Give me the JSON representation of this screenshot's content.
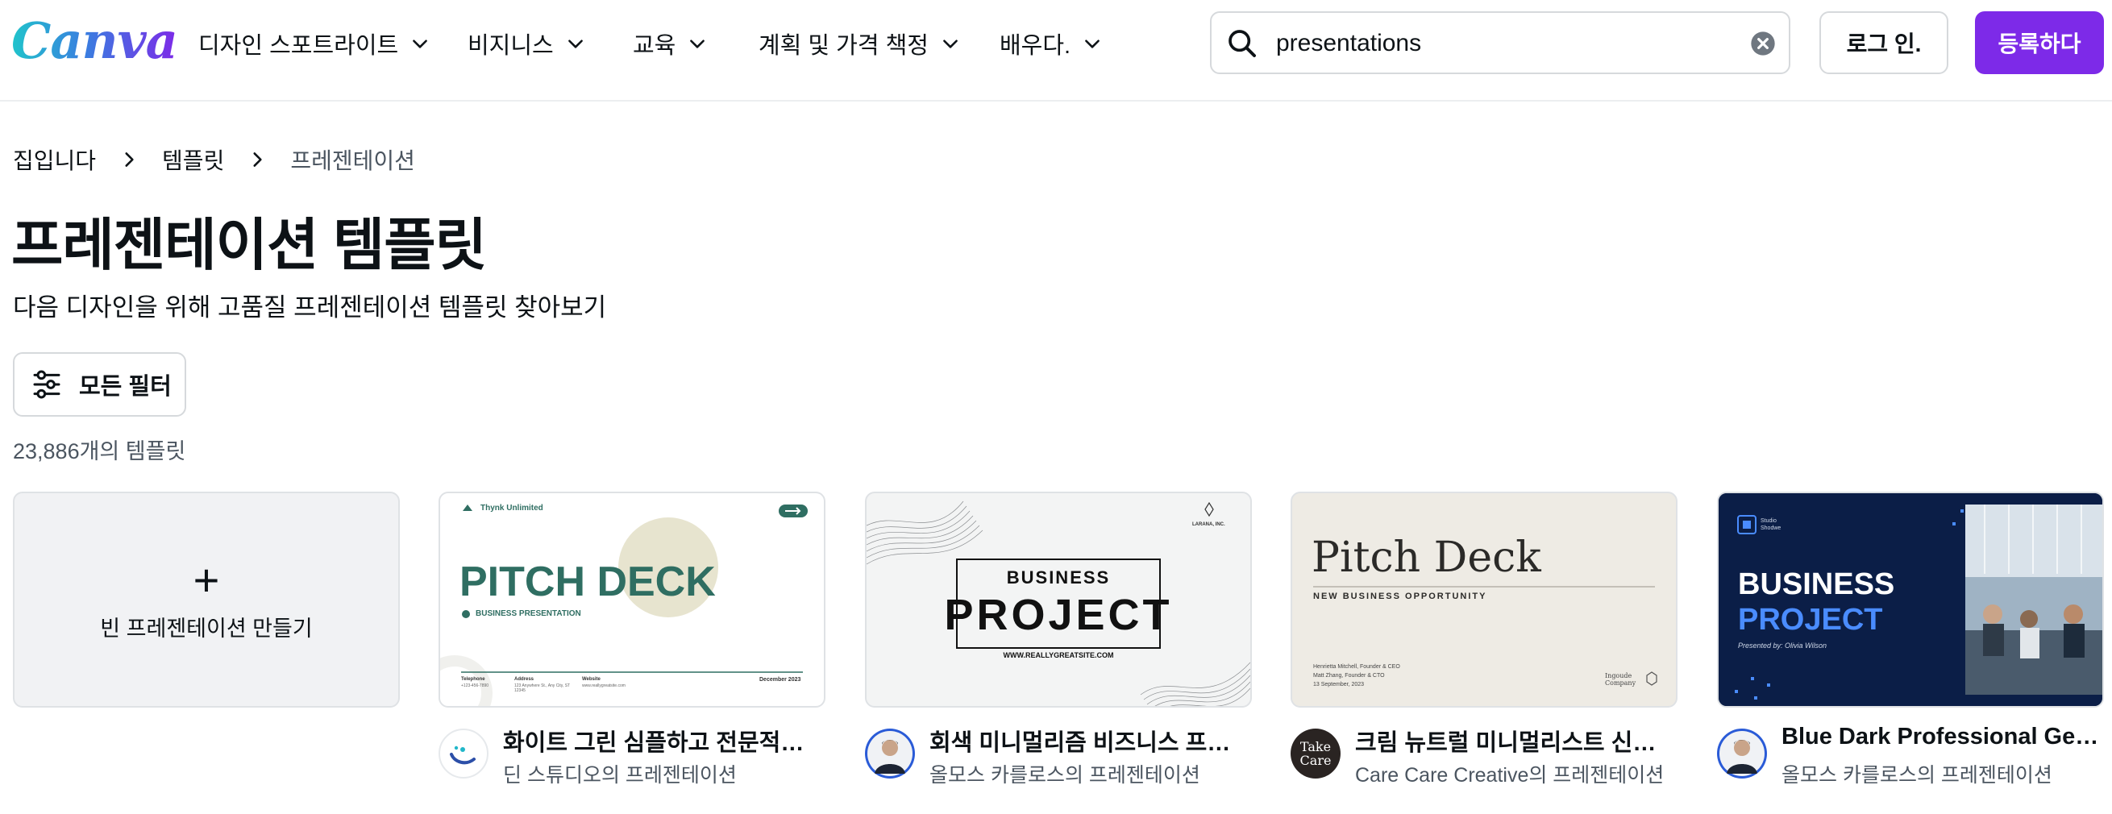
{
  "brand": {
    "logo_text": "Canva"
  },
  "nav": {
    "items": [
      {
        "label": "디자인 스포트라이트"
      },
      {
        "label": "비지니스"
      },
      {
        "label": "교육"
      },
      {
        "label": "계획 및 가격 책정"
      },
      {
        "label": "배우다."
      }
    ]
  },
  "search": {
    "value": "presentations"
  },
  "auth": {
    "login_label": "로그 인.",
    "signup_label": "등록하다"
  },
  "breadcrumb": {
    "items": [
      "집입니다",
      "템플릿",
      "프레젠테이션"
    ]
  },
  "page": {
    "title": "프레젠테이션 템플릿",
    "subtitle": "다음 디자인을 위해 고품질 프레젠테이션 템플릿 찾아보기",
    "filter_label": "모든 필터",
    "result_count": "23,886개의 템플릿"
  },
  "blank_card": {
    "plus": "+",
    "label": "빈 프레젠테이션 만들기"
  },
  "cards": [
    {
      "title": "화이트 그린 심플하고 전문적인 비...",
      "author": "딘 스튜디오의 프레젠테이션",
      "thumb": {
        "brand": "Thynk Unlimited",
        "headline": "PITCH DECK",
        "tag": "BUSINESS PRESENTATION",
        "footer_labels": [
          "Telephone",
          "Address",
          "Website"
        ],
        "footer_values": [
          "+123-456-7890",
          "123 Anywhere St., Any City, ST 12345",
          "www.reallygreatsite.com"
        ],
        "date": "December 2023"
      }
    },
    {
      "title": "회색 미니멀리즘 비즈니스 프로젝...",
      "author": "올모스 카를로스의 프레젠테이션",
      "thumb": {
        "brand": "LARANA, INC.",
        "line1": "BUSINESS",
        "line2": "PROJECT",
        "site": "WWW.REALLYGREATSITE.COM"
      }
    },
    {
      "title": "크림 뉴트럴 미니멀리스트 신사업 ...",
      "author": "Care Care Creative의 프레젠테이션",
      "avatar_text": "Take Care",
      "thumb": {
        "headline": "Pitch Deck",
        "tag": "NEW BUSINESS OPPORTUNITY",
        "names": [
          "Henrietta Mitchell, Founder & CEO",
          "Matt Zhang, Founder & CTO",
          "13 September, 2023"
        ],
        "company": "Ingoude Company"
      }
    },
    {
      "title": "Blue Dark Professional Geo...",
      "author": "올모스 카를로스의 프레젠테이션",
      "thumb": {
        "brand": "Studio Shodwe",
        "line1": "BUSINESS",
        "line2": "PROJECT",
        "presenter": "Presented by: Olivia Wilson"
      }
    }
  ],
  "colors": {
    "accent": "#7d2ae8",
    "pitch_green": "#2f6e62",
    "dark_navy": "#0b1e47",
    "highlight_blue": "#4a8cff"
  }
}
